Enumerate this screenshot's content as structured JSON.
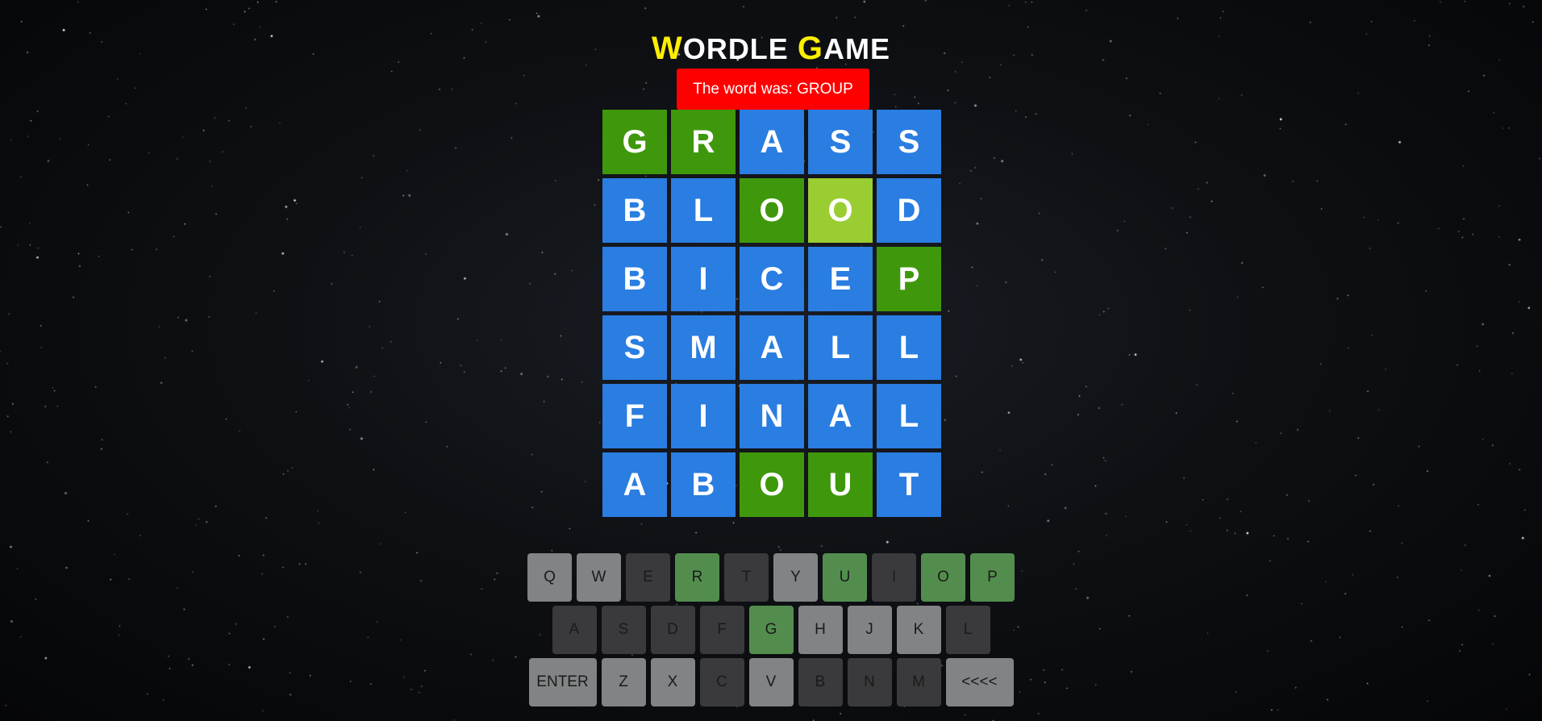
{
  "title": {
    "first": "W",
    "rest1": "ORDLE ",
    "second": "G",
    "rest2": "AME"
  },
  "message": "The word was: GROUP",
  "colors": {
    "absent_tile": "#2a7de1",
    "correct_tile": "#3f980b",
    "present_tile": "#9acd32",
    "message_bg": "#ff0000",
    "title_highlight": "#ffee00",
    "key_unused": "#818384",
    "key_absent": "#3a3a3c",
    "key_correct": "#538d4e"
  },
  "board": [
    [
      {
        "letter": "G",
        "state": "correct"
      },
      {
        "letter": "R",
        "state": "correct"
      },
      {
        "letter": "A",
        "state": "absent"
      },
      {
        "letter": "S",
        "state": "absent"
      },
      {
        "letter": "S",
        "state": "absent"
      }
    ],
    [
      {
        "letter": "B",
        "state": "absent"
      },
      {
        "letter": "L",
        "state": "absent"
      },
      {
        "letter": "O",
        "state": "correct"
      },
      {
        "letter": "O",
        "state": "present"
      },
      {
        "letter": "D",
        "state": "absent"
      }
    ],
    [
      {
        "letter": "B",
        "state": "absent"
      },
      {
        "letter": "I",
        "state": "absent"
      },
      {
        "letter": "C",
        "state": "absent"
      },
      {
        "letter": "E",
        "state": "absent"
      },
      {
        "letter": "P",
        "state": "correct"
      }
    ],
    [
      {
        "letter": "S",
        "state": "absent"
      },
      {
        "letter": "M",
        "state": "absent"
      },
      {
        "letter": "A",
        "state": "absent"
      },
      {
        "letter": "L",
        "state": "absent"
      },
      {
        "letter": "L",
        "state": "absent"
      }
    ],
    [
      {
        "letter": "F",
        "state": "absent"
      },
      {
        "letter": "I",
        "state": "absent"
      },
      {
        "letter": "N",
        "state": "absent"
      },
      {
        "letter": "A",
        "state": "absent"
      },
      {
        "letter": "L",
        "state": "absent"
      }
    ],
    [
      {
        "letter": "A",
        "state": "absent"
      },
      {
        "letter": "B",
        "state": "absent"
      },
      {
        "letter": "O",
        "state": "correct"
      },
      {
        "letter": "U",
        "state": "correct"
      },
      {
        "letter": "T",
        "state": "absent"
      }
    ]
  ],
  "keyboard": [
    [
      {
        "label": "Q",
        "state": "unused"
      },
      {
        "label": "W",
        "state": "unused"
      },
      {
        "label": "E",
        "state": "absent"
      },
      {
        "label": "R",
        "state": "correct"
      },
      {
        "label": "T",
        "state": "absent"
      },
      {
        "label": "Y",
        "state": "unused"
      },
      {
        "label": "U",
        "state": "correct"
      },
      {
        "label": "I",
        "state": "absent"
      },
      {
        "label": "O",
        "state": "correct"
      },
      {
        "label": "P",
        "state": "correct"
      }
    ],
    [
      {
        "label": "A",
        "state": "absent"
      },
      {
        "label": "S",
        "state": "absent"
      },
      {
        "label": "D",
        "state": "absent"
      },
      {
        "label": "F",
        "state": "absent"
      },
      {
        "label": "G",
        "state": "correct"
      },
      {
        "label": "H",
        "state": "unused"
      },
      {
        "label": "J",
        "state": "unused"
      },
      {
        "label": "K",
        "state": "unused"
      },
      {
        "label": "L",
        "state": "absent"
      }
    ],
    [
      {
        "label": "ENTER",
        "state": "unused",
        "wide": true
      },
      {
        "label": "Z",
        "state": "unused"
      },
      {
        "label": "X",
        "state": "unused"
      },
      {
        "label": "C",
        "state": "absent"
      },
      {
        "label": "V",
        "state": "unused"
      },
      {
        "label": "B",
        "state": "absent"
      },
      {
        "label": "N",
        "state": "absent"
      },
      {
        "label": "M",
        "state": "absent"
      },
      {
        "label": "<<<<",
        "state": "unused",
        "wide": true
      }
    ]
  ]
}
